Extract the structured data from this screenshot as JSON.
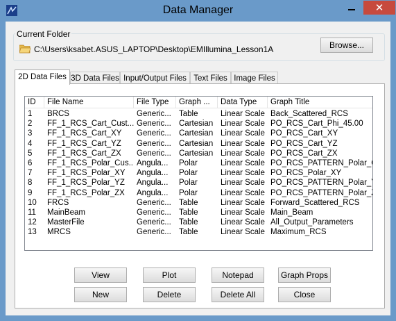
{
  "window": {
    "title": "Data Manager",
    "close_glyph": "✕"
  },
  "current_folder": {
    "label": "Current Folder",
    "path": "C:\\Users\\ksabet.ASUS_LAPTOP\\Desktop\\EMIllumina_Lesson1A",
    "browse_label": "Browse..."
  },
  "tabs": [
    {
      "label": "2D Data Files",
      "active": true
    },
    {
      "label": "3D Data Files",
      "active": false
    },
    {
      "label": "Input/Output Files",
      "active": false
    },
    {
      "label": "Text Files",
      "active": false
    },
    {
      "label": "Image Files",
      "active": false
    }
  ],
  "table": {
    "columns": [
      "ID",
      "File Name",
      "File Type",
      "Graph ...",
      "Data Type",
      "Graph Title"
    ],
    "rows": [
      [
        "1",
        "BRCS",
        "Generic...",
        "Table",
        "Linear Scale",
        "Back_Scattered_RCS"
      ],
      [
        "2",
        "FF_1_RCS_Cart_Cust...",
        "Generic...",
        "Cartesian",
        "Linear Scale",
        "PO_RCS_Cart_Phi_45.00"
      ],
      [
        "3",
        "FF_1_RCS_Cart_XY",
        "Generic...",
        "Cartesian",
        "Linear Scale",
        "PO_RCS_Cart_XY"
      ],
      [
        "4",
        "FF_1_RCS_Cart_YZ",
        "Generic...",
        "Cartesian",
        "Linear Scale",
        "PO_RCS_Cart_YZ"
      ],
      [
        "5",
        "FF_1_RCS_Cart_ZX",
        "Generic...",
        "Cartesian",
        "Linear Scale",
        "PO_RCS_Cart_ZX"
      ],
      [
        "6",
        "FF_1_RCS_Polar_Cus...",
        "Angula...",
        "Polar",
        "Linear Scale",
        "PO_RCS_PATTERN_Polar_Cus"
      ],
      [
        "7",
        "FF_1_RCS_Polar_XY",
        "Angula...",
        "Polar",
        "Linear Scale",
        "PO_RCS_Polar_XY"
      ],
      [
        "8",
        "FF_1_RCS_Polar_YZ",
        "Angula...",
        "Polar",
        "Linear Scale",
        "PO_RCS_PATTERN_Polar_YZ"
      ],
      [
        "9",
        "FF_1_RCS_Polar_ZX",
        "Angula...",
        "Polar",
        "Linear Scale",
        "PO_RCS_PATTERN_Polar_ZX"
      ],
      [
        "10",
        "FRCS",
        "Generic...",
        "Table",
        "Linear Scale",
        "Forward_Scattered_RCS"
      ],
      [
        "11",
        "MainBeam",
        "Generic...",
        "Table",
        "Linear Scale",
        "Main_Beam"
      ],
      [
        "12",
        "MasterFile",
        "Generic...",
        "Table",
        "Linear Scale",
        "All_Output_Parameters"
      ],
      [
        "13",
        "MRCS",
        "Generic...",
        "Table",
        "Linear Scale",
        "Maximum_RCS"
      ]
    ]
  },
  "buttons": {
    "view": "View",
    "plot": "Plot",
    "notepad": "Notepad",
    "graph_props": "Graph Props",
    "new": "New",
    "delete": "Delete",
    "delete_all": "Delete All",
    "close": "Close"
  },
  "colors": {
    "titlebar": "#6a9ac9",
    "close_button": "#c74a3d",
    "face": "#f0f0f0"
  }
}
